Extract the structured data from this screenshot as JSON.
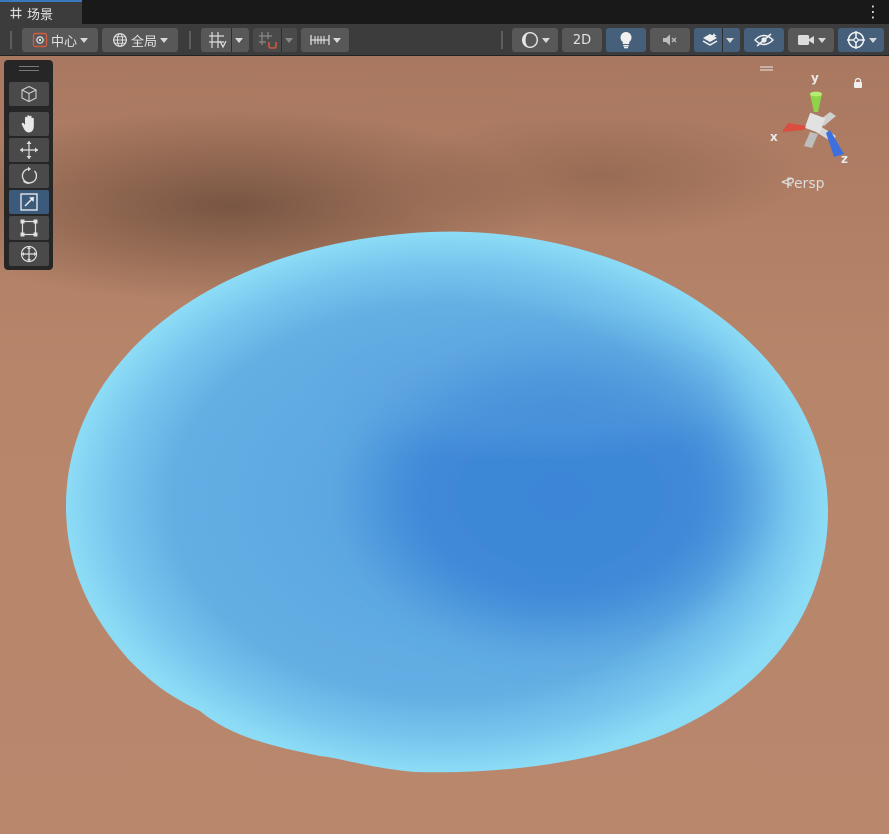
{
  "tab": {
    "icon": "grid-hash-icon",
    "label": "场景"
  },
  "toolbar": {
    "pivot_label": "中心",
    "global_label": "全局",
    "mode_2d_label": "2D",
    "icons": [
      "pivot-center-icon",
      "global-globe-icon",
      "grid-snap-icon",
      "increment-snap-icon",
      "ruler-icon",
      "draw-mode-icon",
      "lighting-bulb-icon",
      "audio-mute-icon",
      "effects-layers-icon",
      "scene-visibility-icon",
      "camera-icon",
      "gizmos-icon"
    ],
    "active_toggles": [
      "lighting",
      "effects",
      "scene-visibility",
      "gizmos"
    ]
  },
  "tools": [
    {
      "name": "view-cube",
      "icon": "cube-icon",
      "active": false
    },
    {
      "name": "hand-tool",
      "icon": "hand-icon",
      "active": false
    },
    {
      "name": "move-tool",
      "icon": "move-arrows-icon",
      "active": false
    },
    {
      "name": "rotate-tool",
      "icon": "rotate-icon",
      "active": false
    },
    {
      "name": "scale-tool",
      "icon": "scale-icon",
      "active": true
    },
    {
      "name": "rect-tool",
      "icon": "rect-transform-icon",
      "active": false
    },
    {
      "name": "transform-tool",
      "icon": "transform-icon",
      "active": false
    }
  ],
  "gizmo": {
    "axis_x": "x",
    "axis_y": "y",
    "axis_z": "z",
    "projection_label": "Persp",
    "colors": {
      "x": "#db4d3e",
      "y": "#8fd34a",
      "z": "#3f6fdc"
    }
  },
  "scene": {
    "terrain_color": "#b7856a",
    "water_edge_color": "#8fdcf6",
    "water_deep_color": "#3c86d6"
  }
}
